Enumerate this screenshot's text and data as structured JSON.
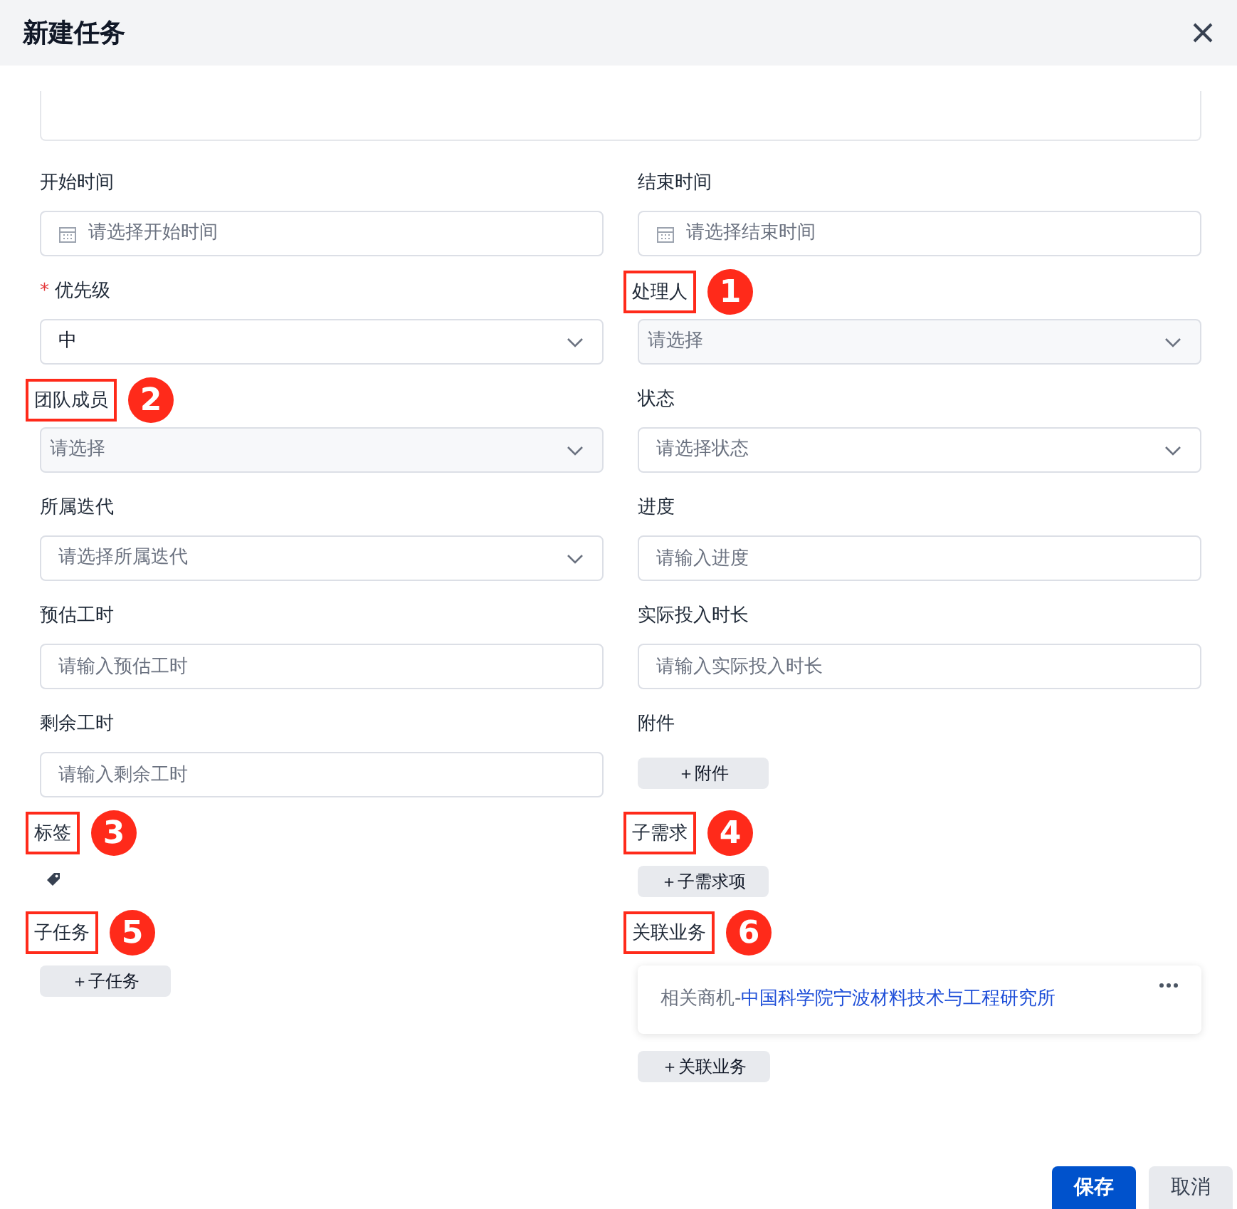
{
  "dialog": {
    "title": "新建任务"
  },
  "fields": [
    {
      "label": "开始时间",
      "kind": "date",
      "placeholder": "请选择开始时间"
    },
    {
      "label": "结束时间",
      "kind": "date",
      "placeholder": "请选择结束时间"
    },
    {
      "label": "优先级",
      "kind": "select",
      "required_mark": "*",
      "value": "中"
    },
    {
      "label": "处理人",
      "kind": "select",
      "shaded": true,
      "placeholder": "请选择",
      "callout": "1"
    },
    {
      "label": "团队成员",
      "kind": "select",
      "shaded": true,
      "placeholder": "请选择",
      "callout": "2"
    },
    {
      "label": "状态",
      "kind": "select",
      "placeholder": "请选择状态"
    },
    {
      "label": "所属迭代",
      "kind": "select",
      "placeholder": "请选择所属迭代"
    },
    {
      "label": "进度",
      "kind": "input",
      "placeholder": "请输入进度"
    },
    {
      "label": "预估工时",
      "kind": "input",
      "placeholder": "请输入预估工时"
    },
    {
      "label": "实际投入时长",
      "kind": "input",
      "placeholder": "请输入实际投入时长"
    },
    {
      "label": "剩余工时",
      "kind": "input",
      "placeholder": "请输入剩余工时"
    },
    {
      "label": "附件",
      "kind": "button",
      "button": "＋附件"
    },
    {
      "label": "标签",
      "kind": "tag",
      "callout": "3"
    },
    {
      "label": "子需求",
      "kind": "button",
      "button": "＋子需求项",
      "callout": "4"
    },
    {
      "label": "子任务",
      "kind": "button",
      "button": "＋子任务",
      "callout": "5"
    },
    {
      "label": "关联业务",
      "kind": "related",
      "callout": "6",
      "card": {
        "prefix": "相关商机-",
        "link": "中国科学院宁波材料技术与工程研究所"
      },
      "button": "＋关联业务"
    }
  ],
  "footer": {
    "buttons": [
      {
        "label": "保存",
        "primary": true
      },
      {
        "label": "取消",
        "primary": false
      }
    ]
  }
}
